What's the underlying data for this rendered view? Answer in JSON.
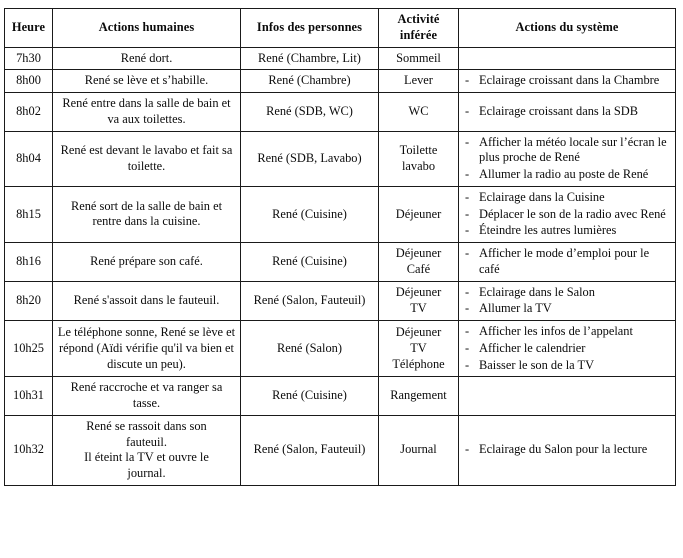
{
  "table": {
    "name": "scenario-journee-rene",
    "columns": [
      {
        "key": "heure",
        "label": "Heure"
      },
      {
        "key": "actions",
        "label": "Actions humaines"
      },
      {
        "key": "infos",
        "label": "Infos des personnes"
      },
      {
        "key": "activite",
        "label": "Activité\ninférée"
      },
      {
        "key": "systeme",
        "label": "Actions du système"
      }
    ],
    "header_labels": {
      "heure": "Heure",
      "actions": "Actions humaines",
      "infos": "Infos des personnes",
      "activite_line1": "Activité",
      "activite_line2": "inférée",
      "systeme": "Actions du système"
    },
    "rows": [
      {
        "heure": "7h30",
        "actions": "René dort.",
        "infos": "René (Chambre, Lit)",
        "activite": [
          "Sommeil"
        ],
        "systeme": []
      },
      {
        "heure": "8h00",
        "actions": "René se lève et s’habille.",
        "infos": "René (Chambre)",
        "activite": [
          "Lever"
        ],
        "systeme": [
          "Eclairage croissant dans la Chambre"
        ]
      },
      {
        "heure": "8h02",
        "actions": "René entre dans la salle de bain et va aux toilettes.",
        "infos": "René (SDB, WC)",
        "activite": [
          "WC"
        ],
        "systeme": [
          "Eclairage croissant dans la SDB"
        ]
      },
      {
        "heure": "8h04",
        "actions": "René est devant le lavabo et fait sa toilette.",
        "infos": "René (SDB, Lavabo)",
        "activite": [
          "Toilette",
          "lavabo"
        ],
        "systeme": [
          "Afficher la météo locale sur l’écran le plus proche de René",
          "Allumer la radio au poste de René"
        ]
      },
      {
        "heure": "8h15",
        "actions": "René sort de la salle de bain et rentre dans la cuisine.",
        "infos": "René (Cuisine)",
        "activite": [
          "Déjeuner"
        ],
        "systeme": [
          "Eclairage dans la Cuisine",
          "Déplacer le son de la radio avec René",
          "Éteindre les autres lumières"
        ]
      },
      {
        "heure": "8h16",
        "actions": "René prépare son café.",
        "infos": "René (Cuisine)",
        "activite": [
          "Déjeuner",
          "Café"
        ],
        "systeme": [
          "Afficher le mode d’emploi pour le café"
        ]
      },
      {
        "heure": "8h20",
        "actions": "René s'assoit dans le fauteuil.",
        "infos": "René (Salon, Fauteuil)",
        "activite": [
          "Déjeuner",
          "TV"
        ],
        "systeme": [
          "Eclairage dans le Salon",
          "Allumer la TV"
        ]
      },
      {
        "heure": "10h25",
        "actions": "Le téléphone sonne, René se lève et répond (Aïdi vérifie qu'il va bien et discute un peu).",
        "infos": "René (Salon)",
        "activite": [
          "Déjeuner",
          "TV",
          "Téléphone"
        ],
        "systeme": [
          "Afficher les infos de l’appelant",
          "Afficher le calendrier",
          "Baisser le son de la TV"
        ]
      },
      {
        "heure": "10h31",
        "actions": "René raccroche et va ranger sa tasse.",
        "infos": "René (Cuisine)",
        "activite": [
          "Rangement"
        ],
        "systeme": []
      },
      {
        "heure": "10h32",
        "actions_lines": [
          "René se rassoit dans son",
          "fauteuil.",
          "Il éteint la TV et ouvre le",
          "journal."
        ],
        "actions": "René se rassoit dans son fauteuil. Il éteint la TV et ouvre le journal.",
        "infos": "René (Salon, Fauteuil)",
        "activite": [
          "Journal"
        ],
        "systeme": [
          "Eclairage du Salon pour la lecture"
        ]
      }
    ]
  },
  "style": {
    "border_color": "#1a1a1a",
    "text_color": "#0b0b0b",
    "page_background": "#ffffff"
  }
}
